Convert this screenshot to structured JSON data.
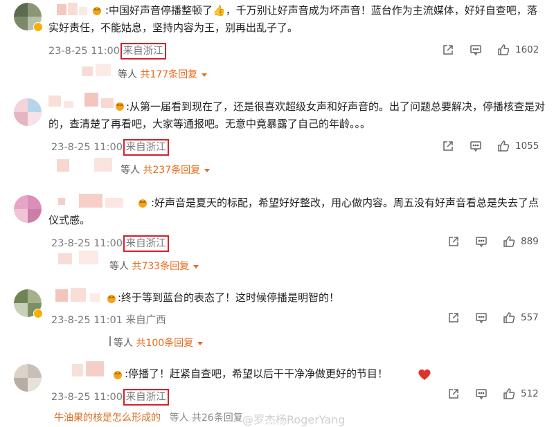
{
  "comments": [
    {
      "text": ":中国好声音停播整顿了👍，千万别让好声音成为坏声音！蓝台作为主流媒体，好好自查吧，落实好责任，不能姑息，坚持内容为王，别再出乱子了。",
      "date": "23-8-25 11:00",
      "location": "来自浙江",
      "likes": "1602",
      "reply_who": "等人",
      "reply_link": "共177条回复"
    },
    {
      "text": ":从第一届看到现在了，还是很喜欢超级女声和好声音的。出了问题总要解决，停播核查是对的，查清楚了再看吧，大家等通报吧。无意中竟暴露了自己的年龄。。。",
      "date": "23-8-25 11:00",
      "location": "来自浙江",
      "likes": "1055",
      "reply_who": "等人",
      "reply_link": "共237条回复"
    },
    {
      "text": ":好声音是夏天的标配，希望好好整改，用心做内容。周五没有好声音看总是失去了点仪式感。",
      "date": "23-8-25 11:00",
      "location": "来自浙江",
      "likes": "889",
      "reply_who": "等人",
      "reply_link": "共733条回复"
    },
    {
      "text": ":终于等到蓝台的表态了！这时候停播是明智的！",
      "date": "23-8-25 11:01",
      "location": "来自广西",
      "likes": "557",
      "reply_who": "等人",
      "reply_link": "共100条回复"
    },
    {
      "text": ":停播了！赶紧自查吧，希望以后干干净净做更好的节目！",
      "date": "23-8-25 11:00",
      "location": "来自浙江",
      "likes": "512",
      "reply_who": "",
      "reply_link": ""
    }
  ],
  "footer": {
    "reply_preview": "牛油果的核是怎么形成的",
    "reply_tail": "等人 共26条回复",
    "watermark": "@罗杰杨RogerYang"
  },
  "colors": {
    "highlight_box": "#d2202d",
    "reply_link": "#e86a1a",
    "vip_badge": "#f5b100",
    "heart": "#e0312c"
  },
  "icons": [
    "share-icon",
    "comment-icon",
    "like-icon",
    "crown-icon",
    "heart-emoji",
    "thumbs-up-emoji"
  ]
}
